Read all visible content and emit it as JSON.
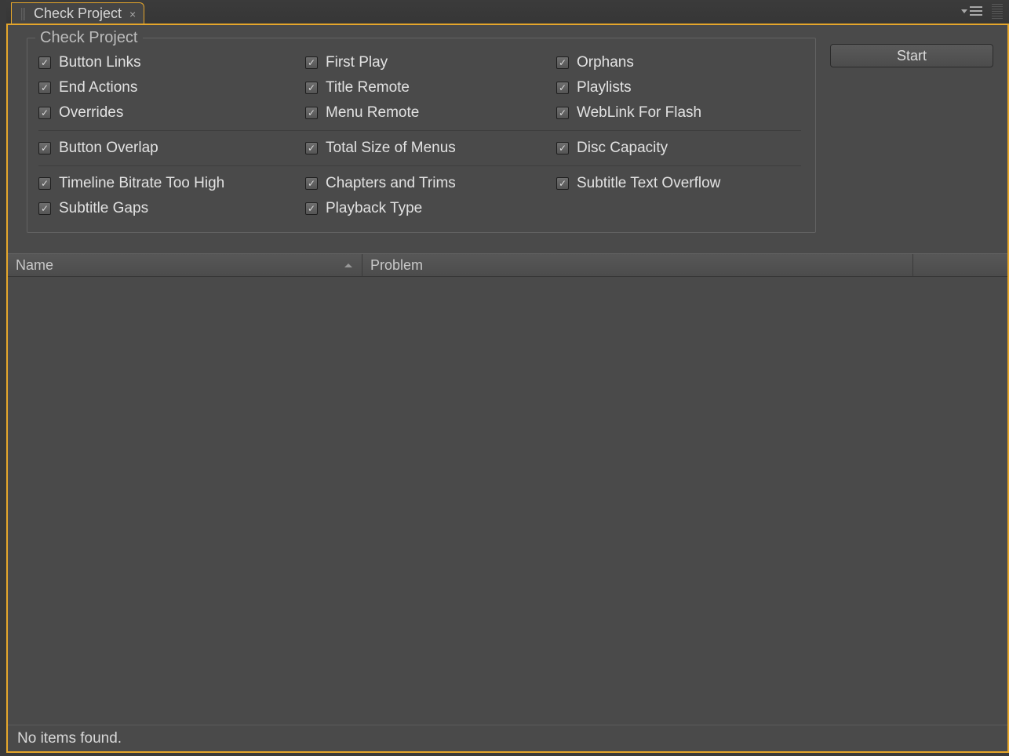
{
  "tab": {
    "title": "Check Project"
  },
  "fieldset": {
    "legend": "Check Project",
    "groups": [
      [
        [
          "Button Links",
          "First Play",
          "Orphans"
        ],
        [
          "End Actions",
          "Title Remote",
          "Playlists"
        ],
        [
          "Overrides",
          "Menu Remote",
          "WebLink For Flash"
        ]
      ],
      [
        [
          "Button Overlap",
          "Total Size of Menus",
          "Disc Capacity"
        ]
      ],
      [
        [
          "Timeline Bitrate Too High",
          "Chapters and Trims",
          "Subtitle Text Overflow"
        ],
        [
          "Subtitle Gaps",
          "Playback Type",
          ""
        ]
      ]
    ]
  },
  "start_button": "Start",
  "list": {
    "columns": {
      "name": "Name",
      "problem": "Problem"
    },
    "status": "No items found."
  }
}
